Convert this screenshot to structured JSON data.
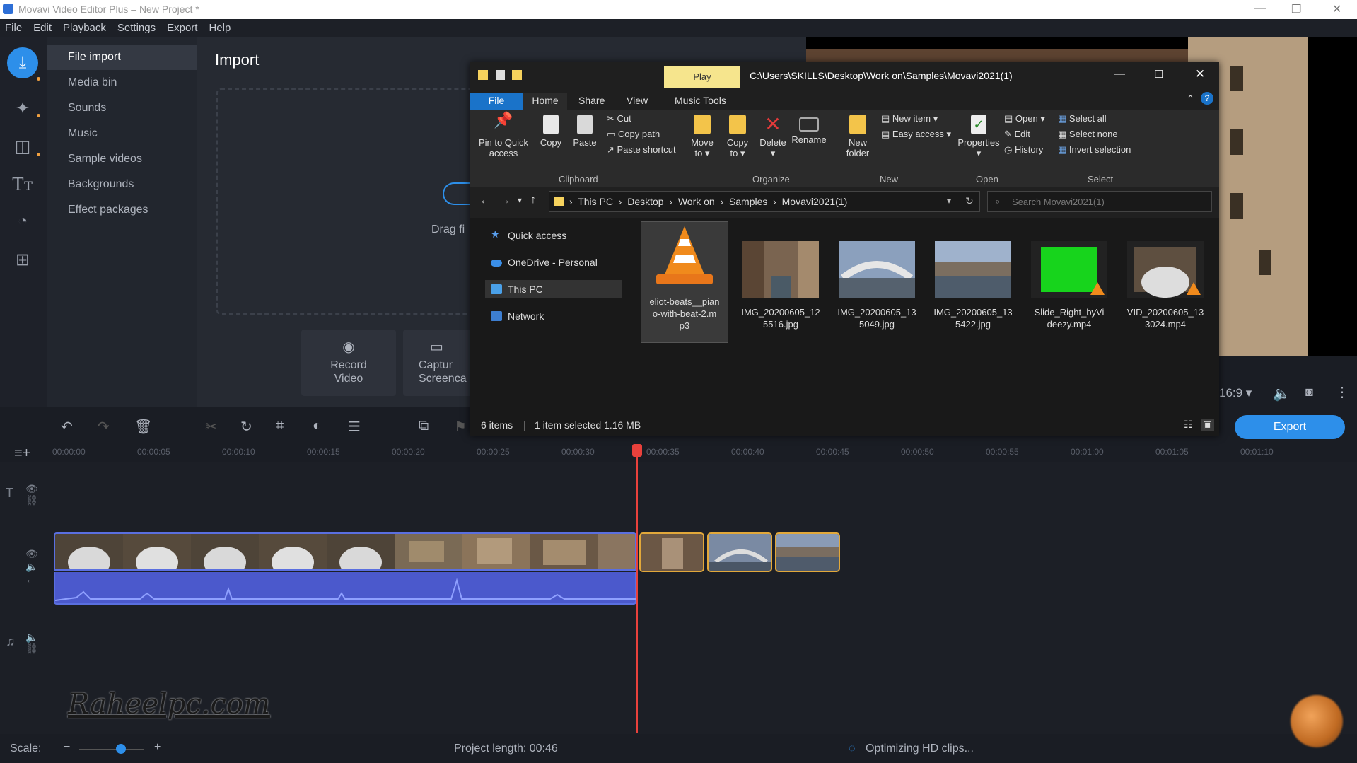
{
  "app": {
    "title": "Movavi Video Editor Plus – New Project *",
    "menu": [
      "File",
      "Edit",
      "Playback",
      "Settings",
      "Export",
      "Help"
    ]
  },
  "sidenav": {
    "items": [
      "File import",
      "Media bin",
      "Sounds",
      "Music",
      "Sample videos",
      "Backgrounds",
      "Effect packages"
    ],
    "active": "File import"
  },
  "import": {
    "title": "Import",
    "drag_text": "Drag fi",
    "record_video": "Record\nVideo",
    "capture": "Captur\nScreenca"
  },
  "explorer": {
    "play_tab": "Play",
    "path_title": "C:\\Users\\SKILLS\\Desktop\\Work on\\Samples\\Movavi2021(1)",
    "tabs": [
      "File",
      "Home",
      "Share",
      "View",
      "Music Tools"
    ],
    "ribbon": {
      "pin": "Pin to Quick\naccess",
      "copy": "Copy",
      "paste": "Paste",
      "cut": "Cut",
      "copy_path": "Copy path",
      "paste_shortcut": "Paste shortcut",
      "move_to": "Move\nto ▾",
      "copy_to": "Copy\nto ▾",
      "delete": "Delete\n▾",
      "rename": "Rename",
      "new_folder": "New\nfolder",
      "new_item": "New item ▾",
      "easy_access": "Easy access ▾",
      "properties": "Properties\n▾",
      "open": "Open ▾",
      "edit": "Edit",
      "history": "History",
      "select_all": "Select all",
      "select_none": "Select none",
      "invert_selection": "Invert selection",
      "groups": [
        "Clipboard",
        "Organize",
        "New",
        "Open",
        "Select"
      ]
    },
    "breadcrumb": [
      "This PC",
      "Desktop",
      "Work on",
      "Samples",
      "Movavi2021(1)"
    ],
    "search_placeholder": "Search Movavi2021(1)",
    "nav": [
      "Quick access",
      "OneDrive - Personal",
      "This PC",
      "Network"
    ],
    "files": [
      {
        "name": "eliot-beats_piano-with-beat-2.mp3",
        "display": "eliot-beats__pian\no-with-beat-2.m\np3",
        "kind": "vlc",
        "selected": true
      },
      {
        "name": "IMG_20200605_125516.jpg",
        "display": "IMG_20200605_12\n5516.jpg",
        "kind": "canal"
      },
      {
        "name": "IMG_20200605_135049.jpg",
        "display": "IMG_20200605_13\n5049.jpg",
        "kind": "bridge"
      },
      {
        "name": "IMG_20200605_135422.jpg",
        "display": "IMG_20200605_13\n5422.jpg",
        "kind": "grand-canal"
      },
      {
        "name": "Slide_Right_byVideezy.mp4",
        "display": "Slide_Right_byVi\ndeezy.mp4",
        "kind": "green"
      },
      {
        "name": "VID_20200605_133024.mp4",
        "display": "VID_20200605_13\n3024.mp4",
        "kind": "video"
      }
    ],
    "status_items": "6 items",
    "status_selected": "1 item selected  1.16 MB"
  },
  "player": {
    "aspect": "16:9 ▾"
  },
  "toolbar": {
    "export_label": "Export"
  },
  "ruler": [
    "00:00:00",
    "00:00:05",
    "00:00:10",
    "00:00:15",
    "00:00:20",
    "00:00:25",
    "00:00:30",
    "00:00:35",
    "00:00:40",
    "00:00:45",
    "00:00:50",
    "00:00:55",
    "00:01:00",
    "00:01:05",
    "00:01:10"
  ],
  "bottom": {
    "scale_label": "Scale:",
    "project_length": "Project length:  00:46",
    "status": "Optimizing HD clips..."
  },
  "watermark": "Raheelpc.com",
  "colors": {
    "accent": "#2d8fea",
    "playhead": "#e9413c",
    "audio": "#4b59cc",
    "clip_border": "#e2a83a"
  }
}
